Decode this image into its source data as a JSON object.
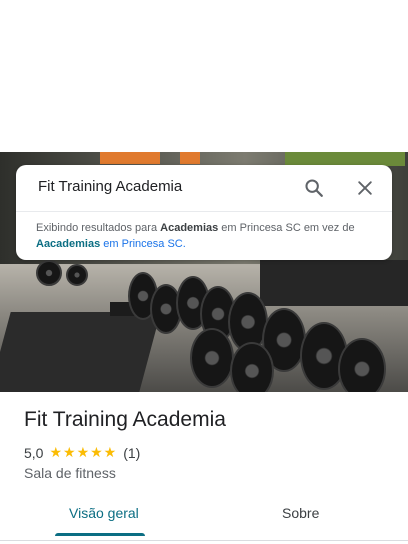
{
  "search": {
    "query": "Fit Training Academia",
    "notice": {
      "prefix": "Exibindo resultados para ",
      "shown_term": "Academias",
      "middle": " em Princesa SC em vez de ",
      "original_term": "Aacademias",
      "suffix": " em Princesa SC."
    },
    "search_icon": "search-icon",
    "clear_icon": "close-icon"
  },
  "place": {
    "title": "Fit Training Academia",
    "rating": "5,0",
    "stars": "★★★★★",
    "review_count": "(1)",
    "category": "Sala de fitness"
  },
  "tabs": [
    {
      "label": "Visão geral",
      "active": true
    },
    {
      "label": "Sobre",
      "active": false
    }
  ],
  "colors": {
    "accent": "#0b6e83",
    "star": "#fbbc04",
    "link": "#1a73e8"
  }
}
